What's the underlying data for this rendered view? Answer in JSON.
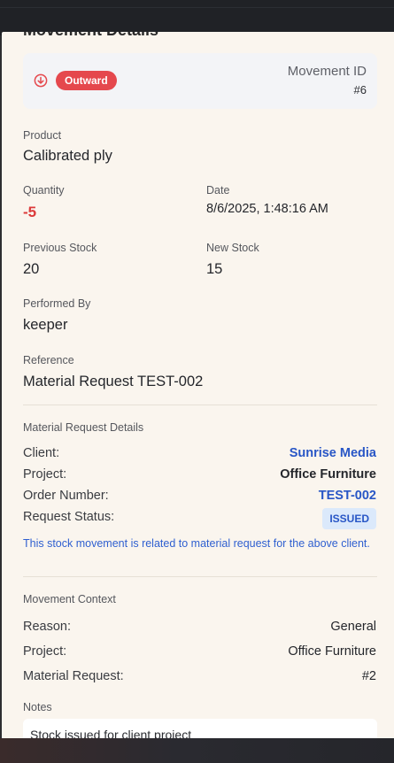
{
  "modal": {
    "title": "Movement Details",
    "summary": {
      "type_badge": "Outward",
      "movement_id_label": "Movement ID",
      "movement_id_value": "#6"
    },
    "fields": {
      "product_label": "Product",
      "product_value": "Calibrated ply",
      "quantity_label": "Quantity",
      "quantity_value": "-5",
      "date_label": "Date",
      "date_value": "8/6/2025, 1:48:16 AM",
      "previous_stock_label": "Previous Stock",
      "previous_stock_value": "20",
      "new_stock_label": "New Stock",
      "new_stock_value": "15",
      "performed_by_label": "Performed By",
      "performed_by_value": "keeper",
      "reference_label": "Reference",
      "reference_value": "Material Request TEST-002"
    },
    "material_request": {
      "section_title": "Material Request Details",
      "client_label": "Client:",
      "client_value": "Sunrise Media",
      "project_label": "Project:",
      "project_value": "Office Furniture",
      "order_number_label": "Order Number:",
      "order_number_value": "TEST-002",
      "request_status_label": "Request Status:",
      "request_status_value": "ISSUED",
      "info_note": "This stock movement is related to material request for the above client."
    },
    "movement_context": {
      "section_title": "Movement Context",
      "reason_label": "Reason:",
      "reason_value": "General",
      "project_label": "Project:",
      "project_value": "Office Furniture",
      "material_request_label": "Material Request:",
      "material_request_value": "#2"
    },
    "notes": {
      "section_title": "Notes",
      "text": "Stock issued for client project"
    }
  },
  "icons": {
    "outward": "arrow-down-circle-icon"
  },
  "colors": {
    "panel_bg": "#faf5ee",
    "outward_badge": "#e5484d",
    "negative_qty": "#dc3a3a",
    "link_blue": "#2856c6",
    "status_badge_bg": "#dbe9fb"
  }
}
